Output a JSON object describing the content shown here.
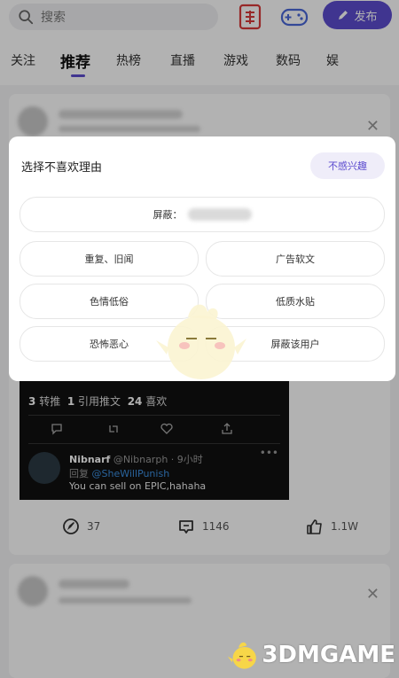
{
  "header": {
    "search_placeholder": "搜索",
    "post_button": "发布"
  },
  "tabs": [
    "关注",
    "推荐",
    "热榜",
    "直播",
    "游戏",
    "数码",
    "娱"
  ],
  "tweet": {
    "stats": {
      "retweets": "3",
      "retweets_label": "转推",
      "quotes": "1",
      "quotes_label": "引用推文",
      "likes": "24",
      "likes_label": "喜欢"
    },
    "reply": {
      "name": "Nibnarf",
      "handle": "@Nibnarph · 9小时",
      "reply_prefix": "回复",
      "reply_to": "@SheWillPunish",
      "text": "You can sell on EPIC,hahaha"
    }
  },
  "actions": {
    "share_count": "37",
    "comment_count": "1146",
    "like_count": "1.1W"
  },
  "dialog": {
    "title": "选择不喜欢理由",
    "not_interested": "不感兴趣",
    "block_label": "屏蔽：",
    "options": [
      "重复、旧闻",
      "广告软文",
      "色情低俗",
      "低质水贴",
      "恐怖恶心",
      "屏蔽该用户"
    ]
  },
  "watermark": {
    "text": "3DMGAME"
  },
  "colors": {
    "accent": "#5c4ccf",
    "red_icon": "#d93a3a",
    "tweet_bg": "#111111"
  }
}
